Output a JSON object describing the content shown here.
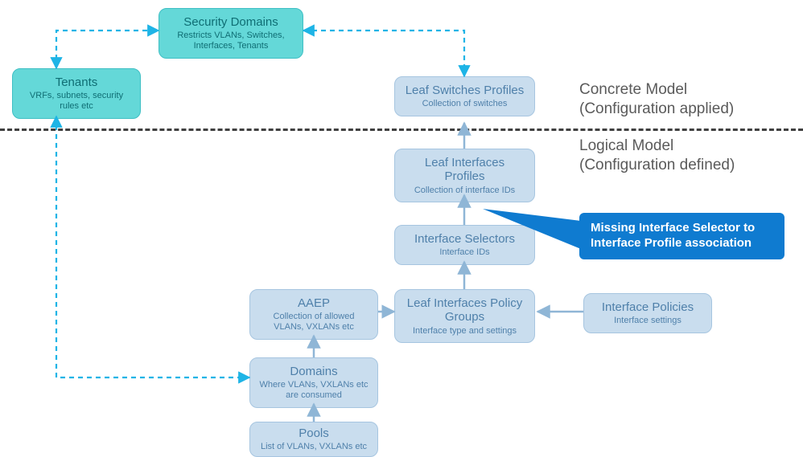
{
  "domain": "Diagram",
  "colors": {
    "teal_bg": "#64d8d8",
    "teal_border": "#3fbfc4",
    "teal_text": "#0f6e74",
    "light_bg": "#c9ddee",
    "light_border": "#a6c5e0",
    "light_text": "#4f80aa",
    "callout_bg": "#0f7bd0",
    "arrow_dashed": "#1eb4e6",
    "arrow_solid": "#8fb6d6",
    "divider": "#404040",
    "section_label": "#5a5a5a"
  },
  "sections": {
    "concrete": {
      "line1": "Concrete Model",
      "line2": "(Configuration applied)"
    },
    "logical": {
      "line1": "Logical Model",
      "line2": "(Configuration defined)"
    }
  },
  "callout": {
    "line1": "Missing Interface Selector to",
    "line2": "Interface Profile association"
  },
  "nodes": {
    "tenants": {
      "title": "Tenants",
      "sub": "VRFs, subnets, security rules etc"
    },
    "security_domains": {
      "title": "Security Domains",
      "sub": "Restricts VLANs, Switches, Interfaces, Tenants"
    },
    "leaf_switches_profiles": {
      "title": "Leaf Switches Profiles",
      "sub": "Collection of switches"
    },
    "leaf_interfaces_profiles": {
      "title": "Leaf Interfaces Profiles",
      "sub": "Collection of interface IDs"
    },
    "interface_selectors": {
      "title": "Interface Selectors",
      "sub": "Interface IDs"
    },
    "leaf_interfaces_policy_groups": {
      "title": "Leaf Interfaces Policy Groups",
      "sub": "Interface type and settings"
    },
    "aaep": {
      "title": "AAEP",
      "sub": "Collection of allowed VLANs, VXLANs etc"
    },
    "interface_policies": {
      "title": "Interface Policies",
      "sub": "Interface settings"
    },
    "domains": {
      "title": "Domains",
      "sub": "Where VLANs, VXLANs etc are consumed"
    },
    "pools": {
      "title": "Pools",
      "sub": "List of VLANs, VXLANs etc"
    }
  },
  "edges": [
    {
      "from": "tenants",
      "to": "security_domains",
      "style": "dashed",
      "bidir": true
    },
    {
      "from": "security_domains",
      "to": "leaf_switches_profiles",
      "style": "dashed",
      "bidir": true
    },
    {
      "from": "tenants",
      "to": "domains",
      "style": "dashed",
      "bidir": true
    },
    {
      "from": "leaf_interfaces_profiles",
      "to": "leaf_switches_profiles",
      "style": "solid",
      "bidir": false
    },
    {
      "from": "interface_selectors",
      "to": "leaf_interfaces_profiles",
      "style": "solid",
      "bidir": false
    },
    {
      "from": "leaf_interfaces_policy_groups",
      "to": "interface_selectors",
      "style": "solid",
      "bidir": false
    },
    {
      "from": "aaep",
      "to": "leaf_interfaces_policy_groups",
      "style": "solid",
      "bidir": false
    },
    {
      "from": "interface_policies",
      "to": "leaf_interfaces_policy_groups",
      "style": "solid",
      "bidir": false
    },
    {
      "from": "domains",
      "to": "aaep",
      "style": "solid",
      "bidir": false
    },
    {
      "from": "pools",
      "to": "domains",
      "style": "solid",
      "bidir": false
    }
  ]
}
